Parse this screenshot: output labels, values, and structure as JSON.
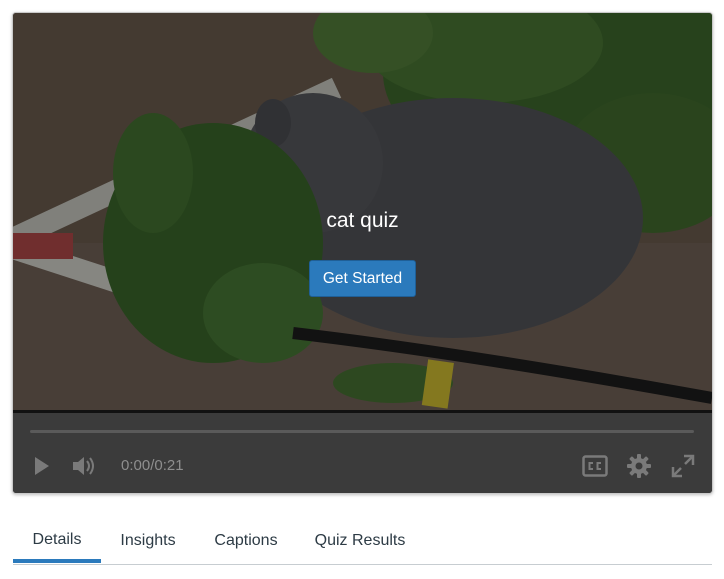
{
  "video": {
    "title": "cat quiz",
    "start_button": "Get Started"
  },
  "controls": {
    "time": "0:00/0:21",
    "progress": 0,
    "icons": [
      "play-icon",
      "volume-icon",
      "closed-captions-icon",
      "gear-icon",
      "fullscreen-icon"
    ]
  },
  "tabs": [
    {
      "label": "Details",
      "active": true
    },
    {
      "label": "Insights",
      "active": false
    },
    {
      "label": "Captions",
      "active": false
    },
    {
      "label": "Quiz Results",
      "active": false
    }
  ],
  "colors": {
    "accent": "#2b7abc",
    "controls_bg": "#3b3b3b",
    "tab_text": "#2d3b45"
  }
}
